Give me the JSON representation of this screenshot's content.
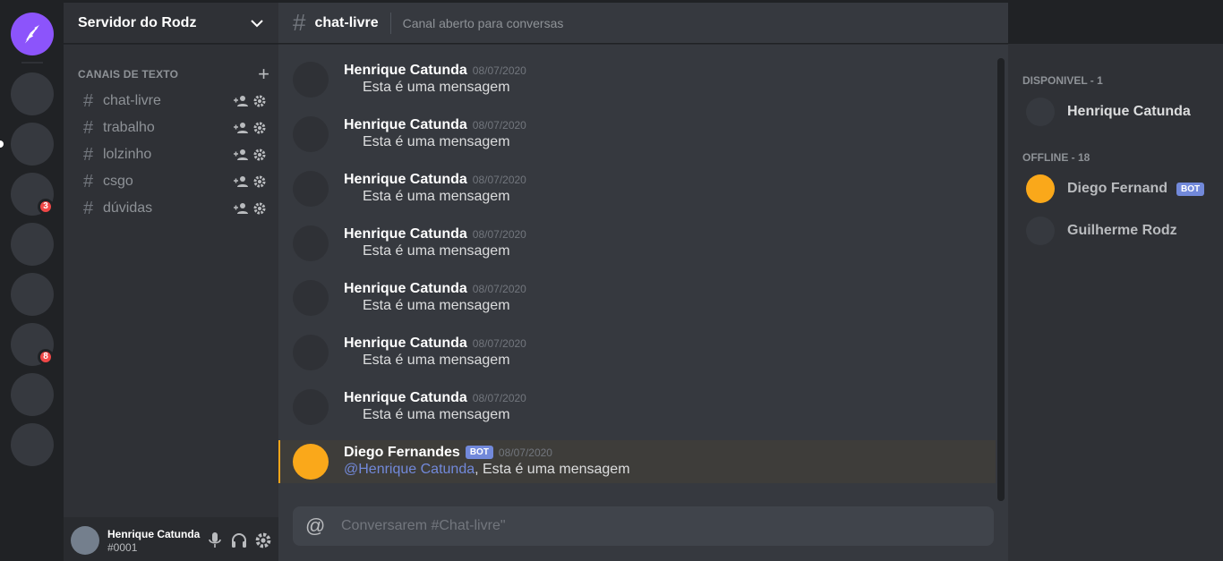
{
  "server": {
    "name": "Servidor do Rodz",
    "badges": [
      "3",
      "8"
    ]
  },
  "sidebar": {
    "category": "CANAIS DE TEXTO",
    "channels": [
      {
        "name": "chat-livre"
      },
      {
        "name": "trabalho"
      },
      {
        "name": "lolzinho"
      },
      {
        "name": "csgo"
      },
      {
        "name": "dúvidas"
      }
    ]
  },
  "user_panel": {
    "name": "Henrique Catunda",
    "tag": "#0001"
  },
  "header": {
    "channel": "chat-livre",
    "topic": "Canal aberto para conversas"
  },
  "messages": [
    {
      "author": "Henrique Catunda",
      "date": "08/07/2020",
      "text": "Esta é uma mensagem"
    },
    {
      "author": "Henrique Catunda",
      "date": "08/07/2020",
      "text": "Esta é uma mensagem"
    },
    {
      "author": "Henrique Catunda",
      "date": "08/07/2020",
      "text": "Esta é uma mensagem"
    },
    {
      "author": "Henrique Catunda",
      "date": "08/07/2020",
      "text": "Esta é uma mensagem"
    },
    {
      "author": "Henrique Catunda",
      "date": "08/07/2020",
      "text": "Esta é uma mensagem"
    },
    {
      "author": "Henrique Catunda",
      "date": "08/07/2020",
      "text": "Esta é uma mensagem"
    },
    {
      "author": "Henrique Catunda",
      "date": "08/07/2020",
      "text": "Esta é uma mensagem"
    }
  ],
  "mention_message": {
    "author": "Diego Fernandes",
    "bot_tag": "BOT",
    "date": "08/07/2020",
    "mention": "@Henrique Catunda",
    "text": ", Esta é uma mensagem"
  },
  "composer": {
    "placeholder": "Conversarem #Chat-livre\""
  },
  "members": {
    "online_label": "DISPONIVEL - 1",
    "online": [
      {
        "name": "Henrique Catunda"
      }
    ],
    "offline_label": "OFFLINE - 18",
    "offline": [
      {
        "name": "Diego Fernand",
        "bot": "BOT"
      },
      {
        "name": "Guilherme Rodz"
      }
    ]
  },
  "colors": {
    "brand": "#8c54fb",
    "mention": "#7289da",
    "bot_avatar": "#faa81a",
    "badge": "#f04747"
  }
}
